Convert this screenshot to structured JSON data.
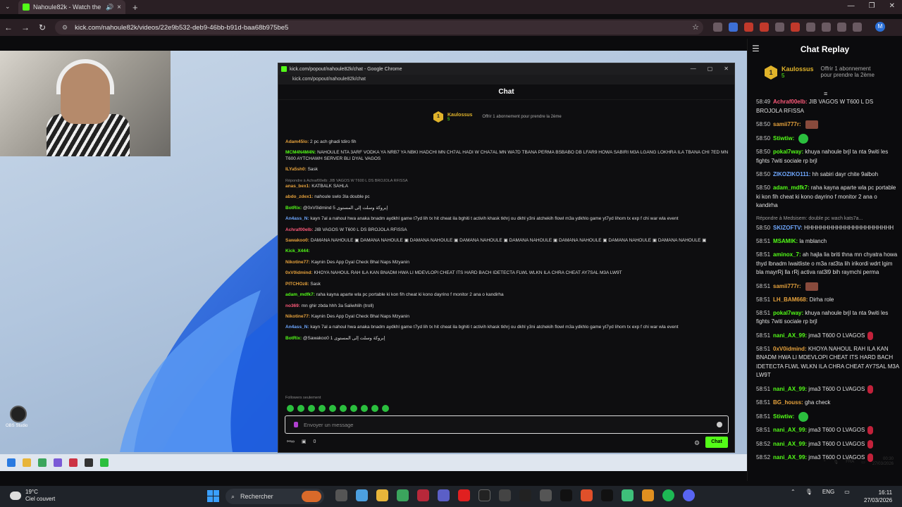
{
  "browser": {
    "tab_title": "Nahoule82k - Watch the V",
    "url": "kick.com/nahoule82k/videos/22e9b532-deb9-46bb-b91d-baa68b975be5"
  },
  "popout": {
    "window_title": "kick.com/popout/nahoule82k/chat - Google Chrome",
    "url": "kick.com/popout/nahoule82k/chat",
    "header": "Chat",
    "pinned": {
      "user": "Kaulossus",
      "count": "5",
      "text": "Offrir 1 abonnement pour prendre la 2ème"
    },
    "messages": [
      {
        "user": "Adam45lo:",
        "color": "#e6a23c",
        "text": "2 pc ach ghadi tdiro fih"
      },
      {
        "user": "MCM4N4M4N:",
        "color": "#53fc18",
        "text": "NAHOULE NTA 3ARF VODKA YA NRB7 YA NBKI HADCHI MN CH7AL HADI W CHA7AL MN WA7D TBANA PERMA BSBABO DB LFAR9 HOWA SABIRI M3A LGANG LOKHRA ILA TBANA CHI 7ED MN T600 AYTCHAWH SERVER BLI DYAL VAGOS"
      },
      {
        "user": "ILYa5sh0:",
        "color": "#e6a23c",
        "text": "Sask"
      },
      {
        "reply": "Répondre à Achraf00elb: JIB VAGOS W T600 L DS BROJOLA RFISSA"
      },
      {
        "user": "anas_bex1:",
        "color": "#e6a23c",
        "text": "KATBALK SAHLA"
      },
      {
        "user": "abdo_zdex1:",
        "color": "#e6a23c",
        "text": "nahoule swlo 3la double pc"
      },
      {
        "user": "BotRix:",
        "color": "#53fc18",
        "text": "@0xV0idmind 5 إبروكة وسلت إلى المستوى"
      },
      {
        "user": "An4ass_N:",
        "color": "#6fa8ff",
        "text": "kayn 7al a nahoul hwa anaka bnadm aydkhl game t7yd lih tx hit cheat ila bghiti t activih khask tkhrj ou dkhl y3ni atchekih flowl m3a ydkhlo game yt7yd lihom tx exp f chi war wla event"
      },
      {
        "user": "Achraf00elb:",
        "color": "#ff5a7a",
        "text": "JIB VAGOS W T600 L DS BROJOLA RFISSA"
      },
      {
        "user": "Sawakoo0:",
        "color": "#e6a23c",
        "text": "DAMANA NAHOULE ▣ DAMANA NAHOULE ▣ DAMANA NAHOULE ▣ DAMANA NAHOULE ▣ DAMANA NAHOULE ▣ DAMANA NAHOULE ▣ DAMANA NAHOULE ▣ DAMANA NAHOULE ▣"
      },
      {
        "user": "Kick_X444:",
        "color": "#53fc18",
        "text": ""
      },
      {
        "user": "Nikotine77:",
        "color": "#e6a23c",
        "text": "Kaynin Des App Dyal Check Bhal Naps Mzyanin"
      },
      {
        "user": "0xV0idmind:",
        "color": "#e6a23c",
        "text": "KHOYA NAHOUL RAH ILA KAN BNADM HWA LI MDEVLOPI CHEAT ITS HARD BACH IDETECTA FLWL WLKN ILA CHRA CHEAT AY7SAL M3A LW9T"
      },
      {
        "user": "PITCHOz8:",
        "color": "#e6a23c",
        "text": "Sask"
      },
      {
        "user": "adam_mdfk7:",
        "color": "#53fc18",
        "text": "raha kayna aparte wla pc portable ki kon fih cheat ki kono dayrino f monitor 2 ana o kandirha"
      },
      {
        "user": "no369:",
        "color": "#ff5a7a",
        "text": "mn ghir zbda hhh 3a 5aliwhlih (troll)"
      },
      {
        "user": "Nikotine77:",
        "color": "#e6a23c",
        "text": "Kaynin Des App Dyal Check Bhal Naps Mzyanin"
      },
      {
        "user": "An4ass_N:",
        "color": "#6fa8ff",
        "text": "kayn 7al a nahoul hwa anaka bnadm aydkhl game t7yd lih tx hit cheat ila bghiti t activih khask tkhrj ou dkhl y3ni atchekih flowl m3a ydkhlo game yt7yd lihom tx exp f chi war wla event"
      },
      {
        "user": "BotRix:",
        "color": "#53fc18",
        "text": "@Sawakoo0 1 إبروكة وسلت إلى المستوى"
      }
    ],
    "followers_only": "Followers seulement",
    "input_placeholder": "Envoyer un message",
    "bottom_count": "0",
    "send_label": "Chat"
  },
  "replay": {
    "title": "Chat Replay",
    "pinned": {
      "user": "Kaulossus",
      "count": "5",
      "text": "Offrir 1 abonnement pour prendre la 2ème"
    },
    "messages": [
      {
        "time": "58:49",
        "user": "Achraf00elb:",
        "color": "#ff5a7a",
        "text": "JIB VAGOS W T600 L DS BROJOLA RFISSA"
      },
      {
        "time": "58:50",
        "user": "samii777r:",
        "color": "#e6a23c",
        "text": "",
        "chip": "brown"
      },
      {
        "time": "58:50",
        "user": "Stiwtiw:",
        "color": "#53fc18",
        "text": "",
        "chip": "green"
      },
      {
        "time": "58:50",
        "user": "pokal7way:",
        "color": "#53fc18",
        "text": "khuya nahoule brjl ta nta 9witi les fights 7witi sociale rp brjl"
      },
      {
        "time": "58:50",
        "user": "ZIKOZIKO111:",
        "color": "#6fa8ff",
        "text": "hh sabiri dayr chite 9alboh"
      },
      {
        "time": "58:50",
        "user": "adam_mdfk7:",
        "color": "#53fc18",
        "text": "raha kayna aparte wla pc portable ki kon fih cheat ki kono dayrino f monitor 2 ana o kandirha"
      },
      {
        "reply": "Répondre à Medsisem: double pc wach kats7a..."
      },
      {
        "time": "58:50",
        "user": "SKIZOFTV:",
        "color": "#6fa8ff",
        "text": "HHHHHHHHHHHHHHHHHHHHHH"
      },
      {
        "time": "58:51",
        "user": "MSAMIK:",
        "color": "#53fc18",
        "text": "la mblanch"
      },
      {
        "time": "58:51",
        "user": "aminox_7:",
        "color": "#53fc18",
        "text": "ah hajla lia briti thna mn chyatra howa thyd lbnadm lwaitliste o m3a rat3ta lih irikordi wdrt lgim bla mayrRj lla rRj activa rat3l9 bih raymchi perma"
      },
      {
        "time": "58:51",
        "user": "samii777r:",
        "color": "#e6a23c",
        "text": "",
        "chip": "brown"
      },
      {
        "time": "58:51",
        "user": "LH_BAM668:",
        "color": "#e6a23c",
        "text": "Dirha role"
      },
      {
        "time": "58:51",
        "user": "pokal7way:",
        "color": "#53fc18",
        "text": "khuya nahoule brjl ta nta 9witi les fights 7witi sociale rp brjl"
      },
      {
        "time": "58:51",
        "user": "nani_AX_99:",
        "color": "#53fc18",
        "text": "jma3 T600 O LVAGOS",
        "chip": "red"
      },
      {
        "time": "58:51",
        "user": "0xV0idmind:",
        "color": "#e6a23c",
        "text": "KHOYA NAHOUL RAH ILA KAN BNADM HWA LI MDEVLOPI CHEAT ITS HARD BACH IDETECTA FLWL WLKN ILA CHRA CHEAT AY7SAL M3A LW9T"
      },
      {
        "time": "58:51",
        "user": "nani_AX_99:",
        "color": "#53fc18",
        "text": "jma3 T600 O LVAGOS",
        "chip": "red"
      },
      {
        "time": "58:51",
        "user": "BG_houss:",
        "color": "#e6a23c",
        "text": "gha check"
      },
      {
        "time": "58:51",
        "user": "Stiwtiw:",
        "color": "#53fc18",
        "text": "",
        "chip": "green"
      },
      {
        "time": "58:51",
        "user": "nani_AX_99:",
        "color": "#53fc18",
        "text": "jma3 T600 O LVAGOS",
        "chip": "red"
      },
      {
        "time": "58:52",
        "user": "nani_AX_99:",
        "color": "#53fc18",
        "text": "jma3 T600 O LVAGOS",
        "chip": "red"
      },
      {
        "time": "58:52",
        "user": "nani_AX_99:",
        "color": "#53fc18",
        "text": "jma3 T600 O LVAGOS",
        "chip": "red"
      }
    ]
  },
  "desktop": {
    "icon_label": "OBS Studio"
  },
  "inner_tray": {
    "lang": "FRA",
    "time": "00:30",
    "date": "27/03/2026"
  },
  "taskbar": {
    "temp": "19°C",
    "weather": "Ciel couvert",
    "search": "Rechercher",
    "lang": "ENG",
    "time": "16:11",
    "date": "27/03/2026"
  }
}
